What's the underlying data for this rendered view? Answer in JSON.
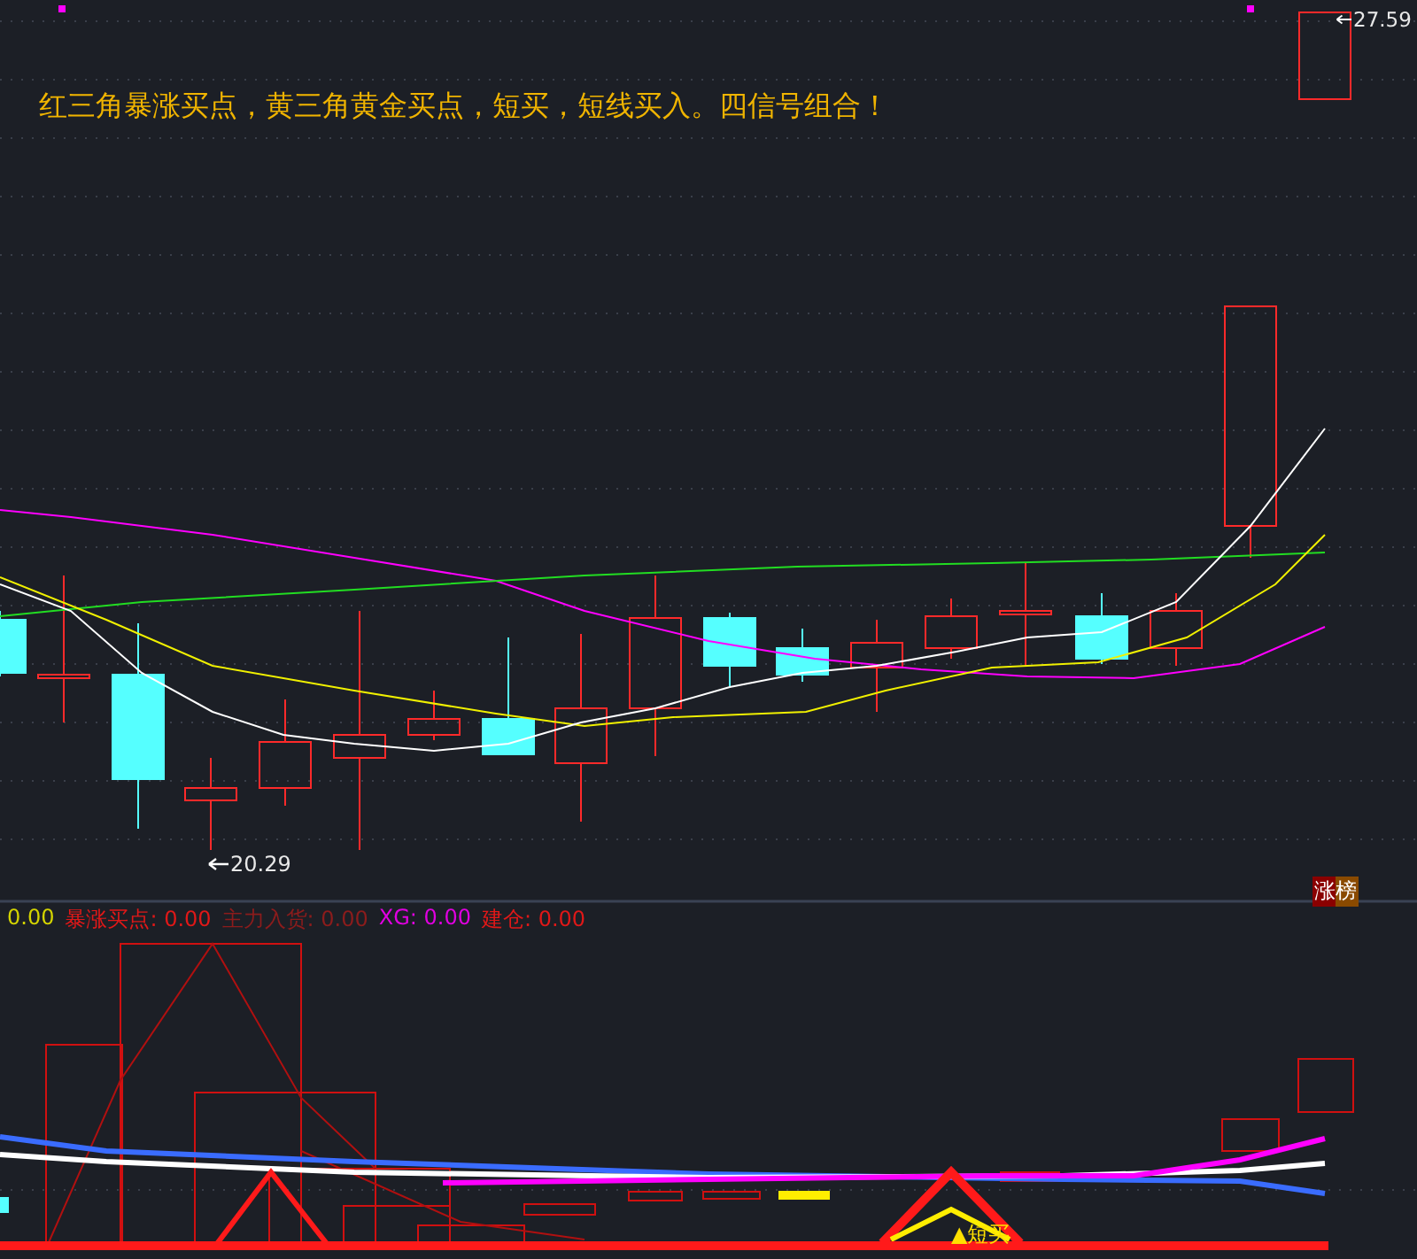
{
  "headline": "红三角暴涨买点，黄三角黄金买点，短买，短线买入。四信号组合！",
  "price_labels": [
    {
      "kind": "high",
      "text": "27.59"
    },
    {
      "kind": "low",
      "text": "20.29"
    }
  ],
  "badge": "涨榜",
  "legend": [
    {
      "text": "0.00",
      "color": "#d4d400"
    },
    {
      "text": "暴涨买点: 0.00",
      "color": "#e01818"
    },
    {
      "text": "主力入货: 0.00",
      "color": "#8c1c1c"
    },
    {
      "text": "XG: 0.00",
      "color": "#e000e0"
    },
    {
      "text": "建仓: 0.00",
      "color": "#e01818"
    }
  ],
  "signal_label": "▲短买"
}
